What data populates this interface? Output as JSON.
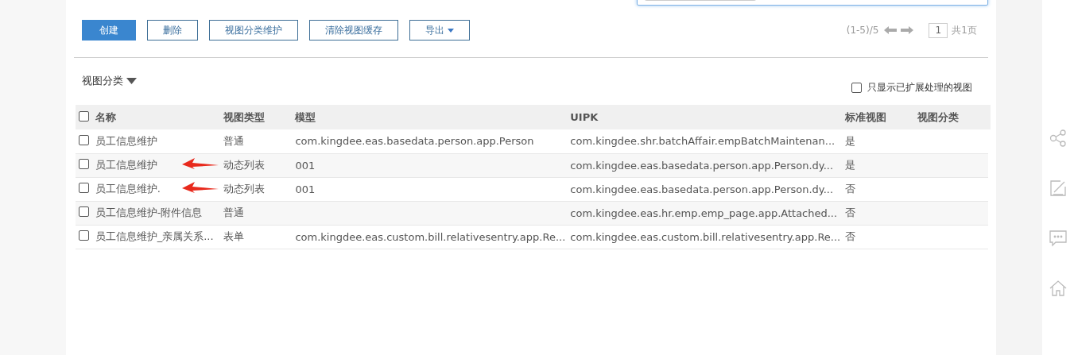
{
  "toolbar": {
    "buttons": [
      {
        "label": "创建",
        "kind": "primary"
      },
      {
        "label": "删除",
        "kind": "normal"
      },
      {
        "label": "视图分类维护",
        "kind": "normal"
      },
      {
        "label": "清除视图缓存",
        "kind": "normal"
      },
      {
        "label": "导出",
        "kind": "dropdown"
      }
    ]
  },
  "pager": {
    "range": "(1-5)/5",
    "page": "1",
    "total": "共1页"
  },
  "category_filter": {
    "label": "视图分类"
  },
  "extended_only": {
    "label": "只显示已扩展处理的视图",
    "checked": false
  },
  "table": {
    "columns": [
      "名称",
      "视图类型",
      "模型",
      "UIPK",
      "标准视图",
      "视图分类"
    ],
    "header_checked": false,
    "rows": [
      {
        "checked": false,
        "marked": false,
        "cells": [
          "员工信息维护",
          "普通",
          "com.kingdee.eas.basedata.person.app.Person",
          "com.kingdee.shr.batchAffair.empBatchMaintenan...",
          "是",
          ""
        ]
      },
      {
        "checked": false,
        "marked": true,
        "cells": [
          "员工信息维护",
          "动态列表",
          "001",
          "com.kingdee.eas.basedata.person.app.Person.dy...",
          "是",
          ""
        ]
      },
      {
        "checked": false,
        "marked": true,
        "cells": [
          "员工信息维护.",
          "动态列表",
          "001",
          "com.kingdee.eas.basedata.person.app.Person.dy...",
          "否",
          ""
        ]
      },
      {
        "checked": false,
        "marked": false,
        "cells": [
          "员工信息维护-附件信息",
          "普通",
          "",
          "com.kingdee.eas.hr.emp.emp_page.app.Attached...",
          "否",
          ""
        ]
      },
      {
        "checked": false,
        "marked": false,
        "cells": [
          "员工信息维护_亲属关系...",
          "表单",
          "com.kingdee.eas.custom.bill.relativesentry.app.Re...",
          "com.kingdee.eas.custom.bill.relativesentry.app.Re...",
          "否",
          ""
        ]
      }
    ]
  }
}
